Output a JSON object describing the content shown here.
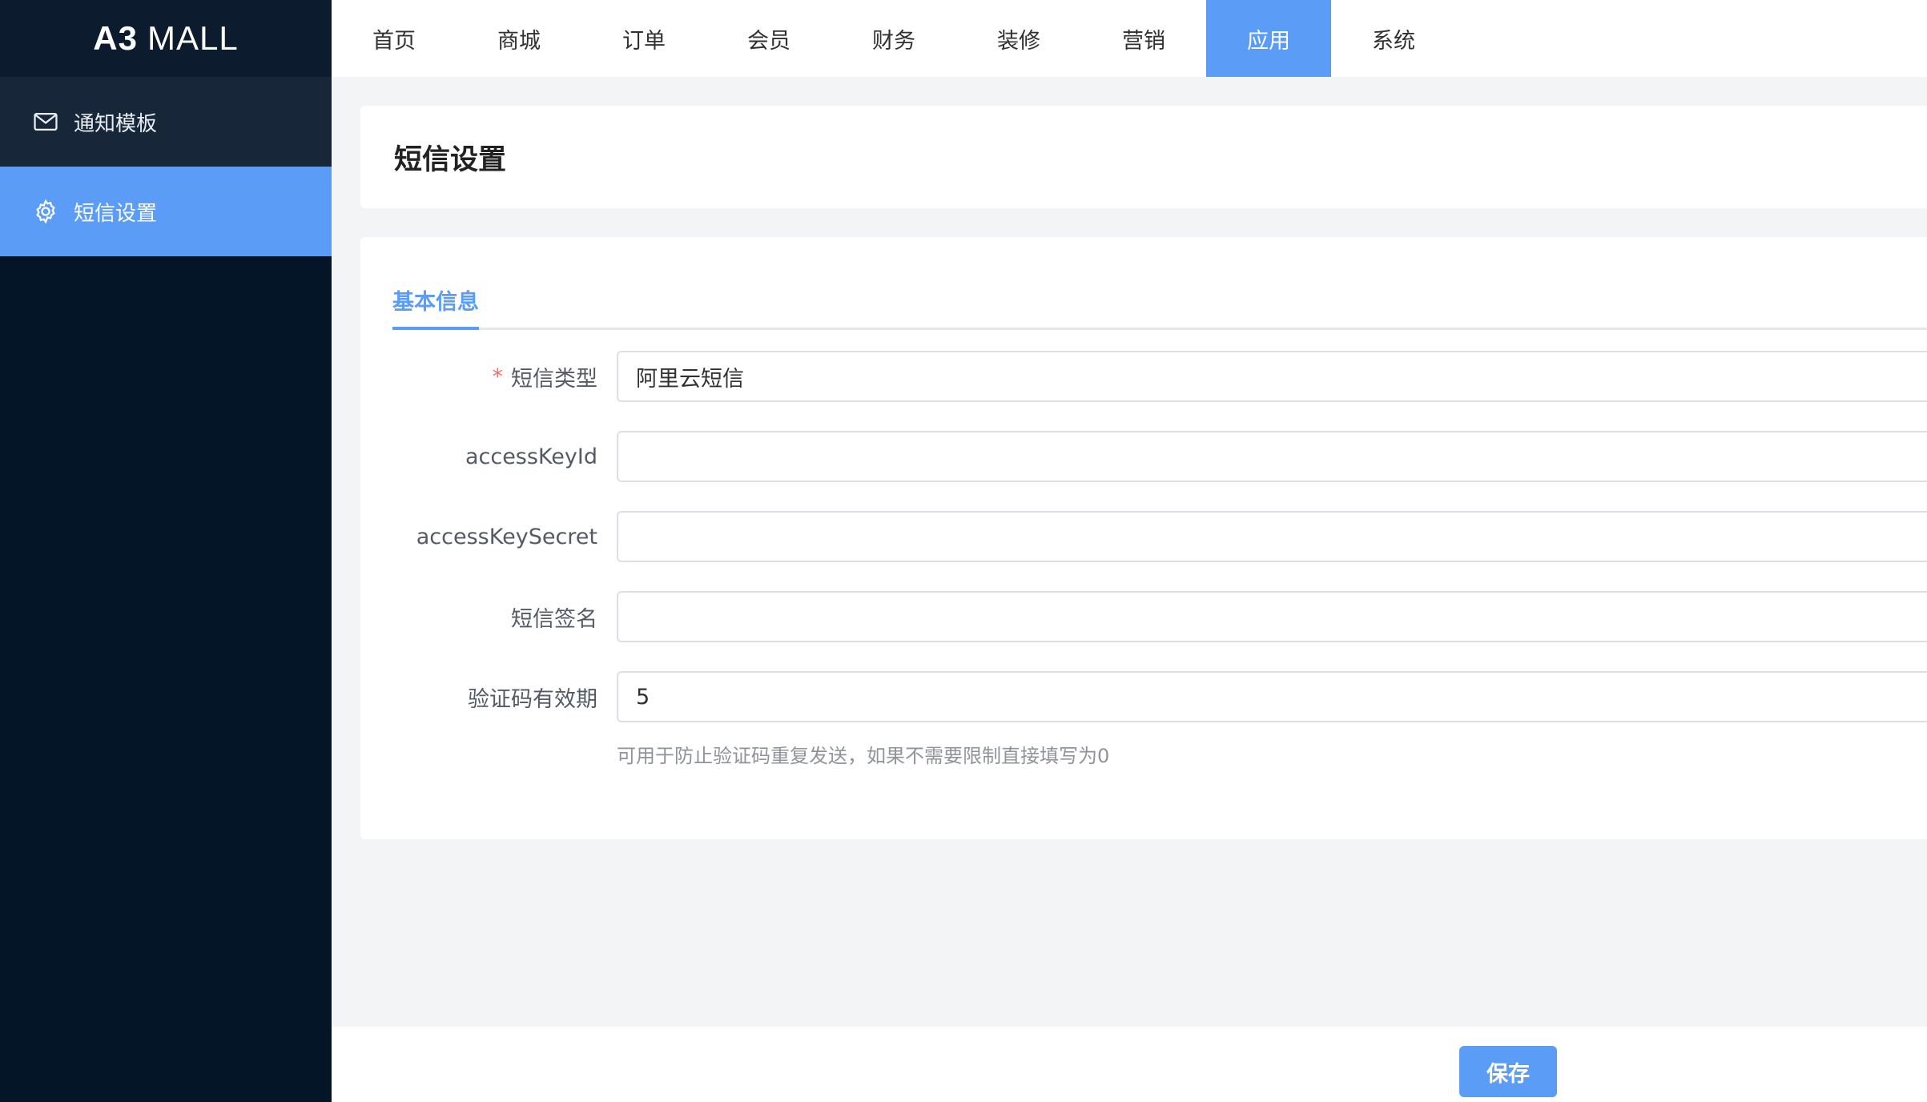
{
  "brand": {
    "bold": "A3",
    "light": "MALL"
  },
  "sidebar": {
    "items": [
      {
        "label": "通知模板",
        "icon": "mail-icon",
        "active": false
      },
      {
        "label": "短信设置",
        "icon": "gear-icon",
        "active": true
      }
    ]
  },
  "topnav": {
    "items": [
      {
        "label": "首页"
      },
      {
        "label": "商城"
      },
      {
        "label": "订单"
      },
      {
        "label": "会员"
      },
      {
        "label": "财务"
      },
      {
        "label": "装修"
      },
      {
        "label": "营销"
      },
      {
        "label": "应用",
        "active": true
      },
      {
        "label": "系统"
      }
    ]
  },
  "page": {
    "title": "短信设置"
  },
  "tabs": {
    "active_label": "基本信息"
  },
  "form": {
    "sms_type": {
      "label": "短信类型",
      "required_mark": "*",
      "value": "阿里云短信"
    },
    "access_key_id": {
      "label": "accessKeyId",
      "value": ""
    },
    "access_key_secret": {
      "label": "accessKeySecret",
      "value": ""
    },
    "sms_signature": {
      "label": "短信签名",
      "value": ""
    },
    "code_validity": {
      "label": "验证码有效期",
      "value": "5",
      "hint": "可用于防止验证码重复发送，如果不需要限制直接填写为0"
    }
  },
  "footer": {
    "save_label": "保存"
  },
  "colors": {
    "accent": "#5b9cf6",
    "sidebar_bg": "#041528",
    "required": "#f56c6c"
  }
}
